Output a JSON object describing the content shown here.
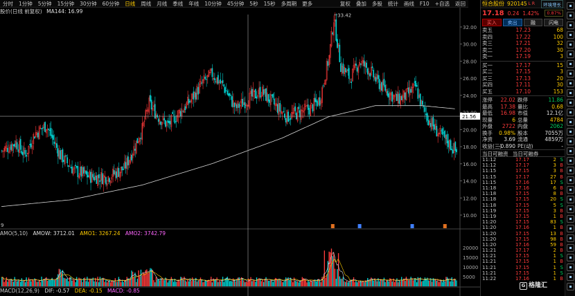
{
  "toolbar": {
    "periods": [
      "分时",
      "1分钟",
      "5分钟",
      "15分钟",
      "30分钟",
      "60分钟",
      "日线",
      "周线",
      "月线",
      "季线",
      "年线",
      "10分钟",
      "45分钟",
      "5秒",
      "15秒",
      "多周期",
      "更多"
    ],
    "active_period": "日线",
    "tools": [
      "复权",
      "叠加",
      "多股",
      "统计",
      "画线",
      "F10",
      "+自选",
      "返回"
    ]
  },
  "main_chart": {
    "title": "股价(日线 前复权)",
    "ma_label": "MA144: 16.99",
    "peak_label": "33.42",
    "crosshair_price": "21.56",
    "yticks": [
      "32.00",
      "30.00",
      "28.00",
      "26.00",
      "24.00",
      "22.00",
      "20.00",
      "18.00",
      "16.00",
      "14.00",
      "12.00",
      "10.00"
    ],
    "corner_label": "9"
  },
  "sub1": {
    "title": "AMO(5,10)",
    "amow": "AMOW: 3712.01",
    "amo1": "AMO1: 3267.24",
    "amo2": "AMO2: 3742.79",
    "yticks": [
      "20000",
      "15000",
      "10000",
      "5000"
    ]
  },
  "sub2": {
    "title": "MACD(12,26,9)",
    "dif": "DIF: -0.57",
    "dea": "DEA: -0.15",
    "macd": "MACD: -0.85"
  },
  "panel": {
    "name": "恒合股份",
    "code": "920145",
    "badge": "L R",
    "fav_label": "环境增长",
    "last_price": "17.18",
    "change": "0.24",
    "pct": "1.42%",
    "tag": "0.87%",
    "buttons": [
      "买入",
      "卖出",
      "融",
      "闪电"
    ],
    "asks": [
      {
        "label": "卖五",
        "price": "17.23",
        "vol": "68"
      },
      {
        "label": "卖四",
        "price": "17.22",
        "vol": "100"
      },
      {
        "label": "卖三",
        "price": "17.21",
        "vol": "32"
      },
      {
        "label": "卖二",
        "price": "17.20",
        "vol": "30"
      },
      {
        "label": "卖一",
        "price": "17.19",
        "vol": "3"
      }
    ],
    "bids": [
      {
        "label": "买一",
        "price": "17.17",
        "vol": "15"
      },
      {
        "label": "买二",
        "price": "17.15",
        "vol": "3"
      },
      {
        "label": "买三",
        "price": "17.13",
        "price_note": "",
        "vol": "20"
      },
      {
        "label": "买四",
        "price": "17.11",
        "vol": "30"
      },
      {
        "label": "买五",
        "price": "17.10",
        "vol": "153"
      }
    ],
    "stats": [
      {
        "k1": "涨停",
        "v1": "22.02",
        "c1": "#ff3b3b",
        "k2": "跌停",
        "v2": "11.86",
        "c2": "#00d060"
      },
      {
        "k1": "最高",
        "v1": "17.38",
        "c1": "#ff3b3b",
        "k2": "量比",
        "v2": "0.68",
        "c2": "#ffcc00"
      },
      {
        "k1": "最低",
        "v1": "16.98",
        "c1": "#ff3b3b",
        "k2": "市值",
        "v2": "12.1亿",
        "c2": "#e0e0e0"
      },
      {
        "k1": "现量",
        "v1": "6",
        "c1": "#ffcc00",
        "k2": "总量",
        "v2": "4784",
        "c2": "#ffcc00"
      },
      {
        "k1": "外盘",
        "v1": "2722",
        "c1": "#ff3b3b",
        "k2": "内盘",
        "v2": "2062",
        "c2": "#00d060"
      },
      {
        "k1": "换手",
        "v1": "0.98%",
        "c1": "#ffcc00",
        "k2": "股本",
        "v2": "7055万",
        "c2": "#e0e0e0"
      },
      {
        "k1": "净资",
        "v1": "3.69",
        "c1": "#e0e0e0",
        "k2": "流通",
        "v2": "4859万",
        "c2": "#e0e0e0"
      },
      {
        "k1": "收益(三)",
        "v1": "-0.890",
        "c1": "#e0e0e0",
        "k2": "PE(动)",
        "v2": "-",
        "c2": "#e0e0e0"
      }
    ],
    "section_title_1": "当日可融资",
    "section_title_2": "当日可融券",
    "ticks": [
      {
        "t": "11:12",
        "p": "17.17",
        "v": "2",
        "d": "S",
        "dc": "#00d060"
      },
      {
        "t": "11:12",
        "p": "17.17",
        "v": "3",
        "d": "B",
        "dc": "#ff3b3b"
      },
      {
        "t": "11:15",
        "p": "17.15",
        "v": "3",
        "d": "B",
        "dc": "#ff3b3b"
      },
      {
        "t": "11:15",
        "p": "17.17",
        "v": "27",
        "d": "B",
        "dc": "#ff3b3b"
      },
      {
        "t": "11:15",
        "p": "17.16",
        "v": "17",
        "d": "S",
        "dc": "#00d060"
      },
      {
        "t": "11:18",
        "p": "17.16",
        "v": "6",
        "d": "B",
        "dc": "#ff3b3b"
      },
      {
        "t": "11:18",
        "p": "17.15",
        "v": "8",
        "d": "B",
        "dc": "#ff3b3b"
      },
      {
        "t": "11:18",
        "p": "17.15",
        "v": "20",
        "d": "S",
        "dc": "#00d060"
      },
      {
        "t": "11:18",
        "p": "17.15",
        "v": "5",
        "d": "S",
        "dc": "#00d060"
      },
      {
        "t": "11:19",
        "p": "17.15",
        "v": "3",
        "d": "B",
        "dc": "#ff3b3b"
      },
      {
        "t": "11:19",
        "p": "17.15",
        "v": "1",
        "d": "B",
        "dc": "#ff3b3b"
      },
      {
        "t": "11:20",
        "p": "17.15",
        "v": "83",
        "d": "S",
        "dc": "#00d060"
      },
      {
        "t": "11:20",
        "p": "17.16",
        "v": "1",
        "d": "B",
        "dc": "#ff3b3b"
      },
      {
        "t": "11:20",
        "p": "17.15",
        "v": "13",
        "d": "B",
        "dc": "#ff3b3b"
      },
      {
        "t": "11:20",
        "p": "17.15",
        "v": "98",
        "d": "B",
        "dc": "#ff3b3b"
      },
      {
        "t": "11:20",
        "p": "17.16",
        "v": "59",
        "d": "B",
        "dc": "#ff3b3b"
      },
      {
        "t": "11:21",
        "p": "17.17",
        "v": "2",
        "d": "B",
        "dc": "#ff3b3b"
      },
      {
        "t": "11:21",
        "p": "17.15",
        "v": "1",
        "d": "S",
        "dc": "#00d060"
      },
      {
        "t": "11:21",
        "p": "17.15",
        "v": "1",
        "d": "B",
        "dc": "#ff3b3b"
      },
      {
        "t": "11:21",
        "p": "17.15",
        "v": "1",
        "d": "S",
        "dc": "#00d060"
      },
      {
        "t": "11:21",
        "p": "17.15",
        "v": "1",
        "d": "S",
        "dc": "#00d060"
      },
      {
        "t": "11:22",
        "p": "17.16",
        "v": "1",
        "d": "B",
        "dc": "#ff3b3b"
      }
    ]
  },
  "strip_icons": [
    "menu-icon",
    "chart-icon",
    "list-icon",
    "news-icon",
    "grid-icon",
    "flag-icon",
    "star-icon",
    "bell-icon",
    "gear-icon",
    "share-icon",
    "lock-icon",
    "user-icon",
    "cloud-icon",
    "tag-icon",
    "book-icon",
    "info-icon",
    "trade-icon",
    "pin-icon",
    "help-icon",
    "link-icon",
    "mail-icon",
    "search-icon",
    "home-icon",
    "eye-icon",
    "chat-icon",
    "pie-icon",
    "plus-icon",
    "minus-icon",
    "more-icon",
    "back-icon"
  ],
  "watermark": "格隆汇",
  "colors": {
    "up": "#ff3b3b",
    "down": "#00d0d0",
    "ma": "#d8d8d8",
    "accent": "#ffcc00"
  }
}
